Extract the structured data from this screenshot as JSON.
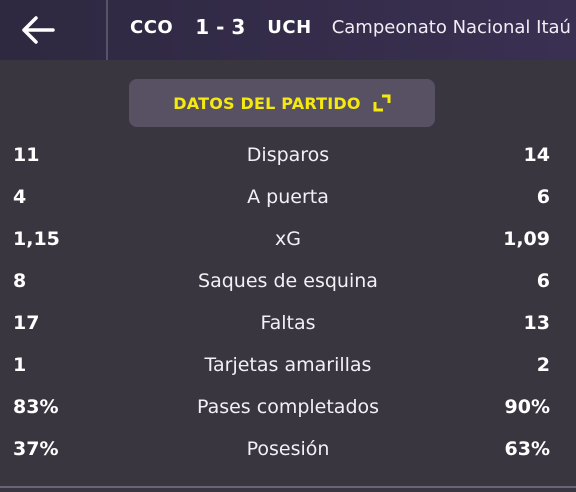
{
  "match": {
    "home_team": "CCO",
    "score": "1 - 3",
    "away_team": "UCH",
    "competition": "Campeonato Nacional Itaú"
  },
  "panel": {
    "title": "DATOS DEL PARTIDO"
  },
  "icons": {
    "back": "arrow-left-icon",
    "expand": "expand-icon"
  },
  "colors": {
    "accent": "#f5e90f",
    "background": "#3a3640",
    "topbar": "#2e2840"
  },
  "stats": [
    {
      "label": "Disparos",
      "home": "11",
      "away": "14"
    },
    {
      "label": "A puerta",
      "home": "4",
      "away": "6"
    },
    {
      "label": "xG",
      "home": "1,15",
      "away": "1,09"
    },
    {
      "label": "Saques de esquina",
      "home": "8",
      "away": "6"
    },
    {
      "label": "Faltas",
      "home": "17",
      "away": "13"
    },
    {
      "label": "Tarjetas amarillas",
      "home": "1",
      "away": "2"
    },
    {
      "label": "Pases completados",
      "home": "83%",
      "away": "90%"
    },
    {
      "label": "Posesión",
      "home": "37%",
      "away": "63%"
    }
  ]
}
